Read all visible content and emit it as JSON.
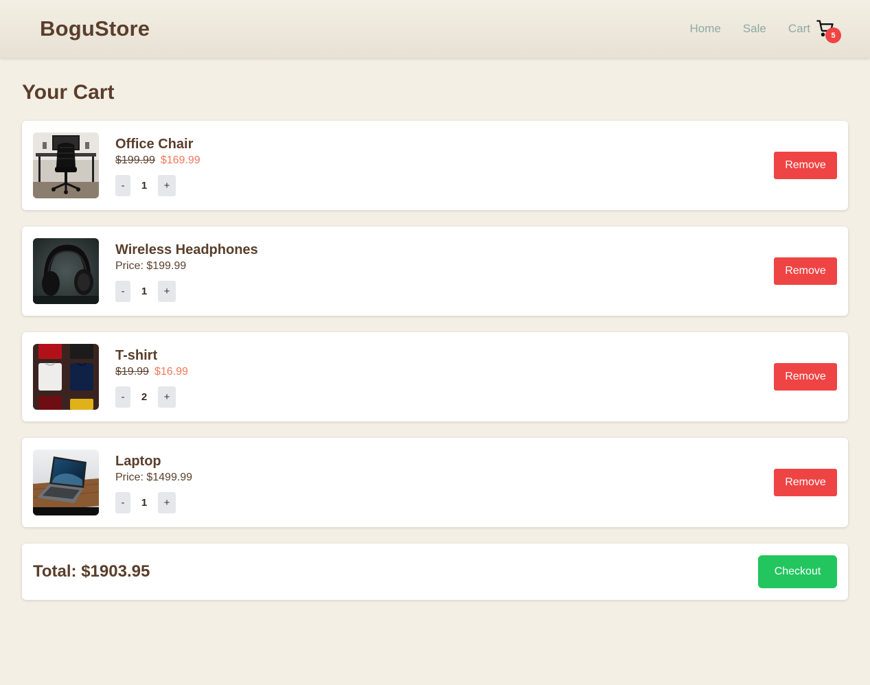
{
  "header": {
    "brand": "BoguStore",
    "nav": {
      "home": "Home",
      "sale": "Sale",
      "cart": "Cart"
    },
    "cart_count": "5"
  },
  "page": {
    "title": "Your Cart"
  },
  "items": [
    {
      "name": "Office Chair",
      "old_price": "$199.99",
      "sale_price": "$169.99",
      "price": "",
      "qty": "1",
      "image": "office-chair-desk-photo"
    },
    {
      "name": "Wireless Headphones",
      "old_price": "",
      "sale_price": "",
      "price": "Price: $199.99",
      "qty": "1",
      "image": "headphones-photo"
    },
    {
      "name": "T-shirt",
      "old_price": "$19.99",
      "sale_price": "$16.99",
      "price": "",
      "qty": "2",
      "image": "folded-tshirts-photo"
    },
    {
      "name": "Laptop",
      "old_price": "",
      "sale_price": "",
      "price": "Price: $1499.99",
      "qty": "1",
      "image": "laptop-photo"
    }
  ],
  "controls": {
    "minus": "-",
    "plus": "+",
    "remove": "Remove",
    "checkout": "Checkout"
  },
  "summary": {
    "total": "Total: $1903.95"
  },
  "colors": {
    "background": "#f4efe4",
    "text": "#5a3e2b",
    "nav": "#8fa8a4",
    "sale": "#f0785a",
    "remove": "#ef4444",
    "checkout": "#22c55e",
    "badge": "#ef4444"
  }
}
